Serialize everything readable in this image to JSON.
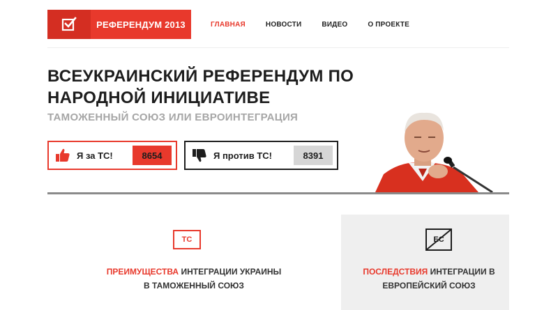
{
  "header": {
    "logo_text": "РЕФЕРЕНДУМ 2013",
    "nav": [
      {
        "label": "ГЛАВНАЯ",
        "active": true
      },
      {
        "label": "НОВОСТИ",
        "active": false
      },
      {
        "label": "ВИДЕО",
        "active": false
      },
      {
        "label": "О ПРОЕКТЕ",
        "active": false
      }
    ]
  },
  "hero": {
    "title": "ВСЕУКРАИНСКИЙ РЕФЕРЕНДУМ ПО НАРОДНОЙ ИНИЦИАТИВЕ",
    "subtitle": "ТАМОЖЕННЫЙ СОЮЗ ИЛИ ЕВРОИНТЕГРАЦИЯ"
  },
  "votes": {
    "for": {
      "label": "Я за ТС!",
      "count": "8654",
      "icon": "thumbs-up-icon"
    },
    "against": {
      "label": "Я против ТС!",
      "count": "8391",
      "icon": "thumbs-down-icon"
    }
  },
  "columns": {
    "left": {
      "badge": "ТС",
      "highlight": "ПРЕИМУЩЕСТВА",
      "line1_rest": " ИНТЕГРАЦИИ УКРАИНЫ",
      "line2": "В ТАМОЖЕННЫЙ СОЮЗ"
    },
    "right": {
      "badge": "ЕС",
      "highlight": "ПОСЛЕДСТВИЯ",
      "line1_rest": " ИНТЕГРАЦИИ В",
      "line2": "ЕВРОПЕЙСКИЙ СОЮЗ"
    }
  },
  "colors": {
    "accent": "#e8392c",
    "dark": "#1d1d1d",
    "muted": "#a6a6a6"
  }
}
